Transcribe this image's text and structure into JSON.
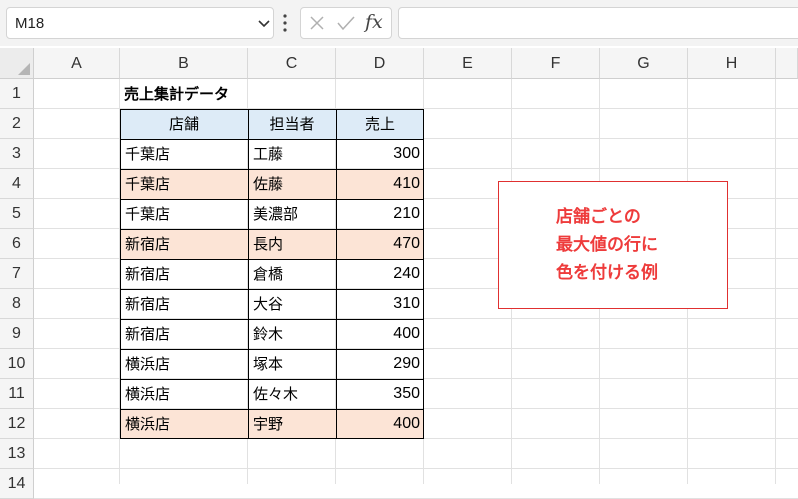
{
  "formula_bar": {
    "name_box": "M18",
    "fx_label": "fx",
    "formula_value": ""
  },
  "columns": [
    "A",
    "B",
    "C",
    "D",
    "E",
    "F",
    "G",
    "H"
  ],
  "rows": [
    "1",
    "2",
    "3",
    "4",
    "5",
    "6",
    "7",
    "8",
    "9",
    "10",
    "11",
    "12",
    "13",
    "14"
  ],
  "sheet": {
    "title": "売上集計データ",
    "headers": [
      "店舗",
      "担当者",
      "売上"
    ],
    "records": [
      {
        "store": "千葉店",
        "person": "工藤",
        "sales": "300",
        "highlight": false
      },
      {
        "store": "千葉店",
        "person": "佐藤",
        "sales": "410",
        "highlight": true
      },
      {
        "store": "千葉店",
        "person": "美濃部",
        "sales": "210",
        "highlight": false
      },
      {
        "store": "新宿店",
        "person": "長内",
        "sales": "470",
        "highlight": true
      },
      {
        "store": "新宿店",
        "person": "倉橋",
        "sales": "240",
        "highlight": false
      },
      {
        "store": "新宿店",
        "person": "大谷",
        "sales": "310",
        "highlight": false
      },
      {
        "store": "新宿店",
        "person": "鈴木",
        "sales": "400",
        "highlight": false
      },
      {
        "store": "横浜店",
        "person": "塚本",
        "sales": "290",
        "highlight": false
      },
      {
        "store": "横浜店",
        "person": "佐々木",
        "sales": "350",
        "highlight": false
      },
      {
        "store": "横浜店",
        "person": "宇野",
        "sales": "400",
        "highlight": true
      }
    ]
  },
  "note": {
    "lines": [
      "店舗ごとの",
      "最大値の行に",
      "色を付ける例"
    ]
  },
  "colors": {
    "header_fill": "#ddebf7",
    "highlight_fill": "#fce4d6",
    "note_text": "#ee3b3b",
    "note_border": "#e03030"
  }
}
